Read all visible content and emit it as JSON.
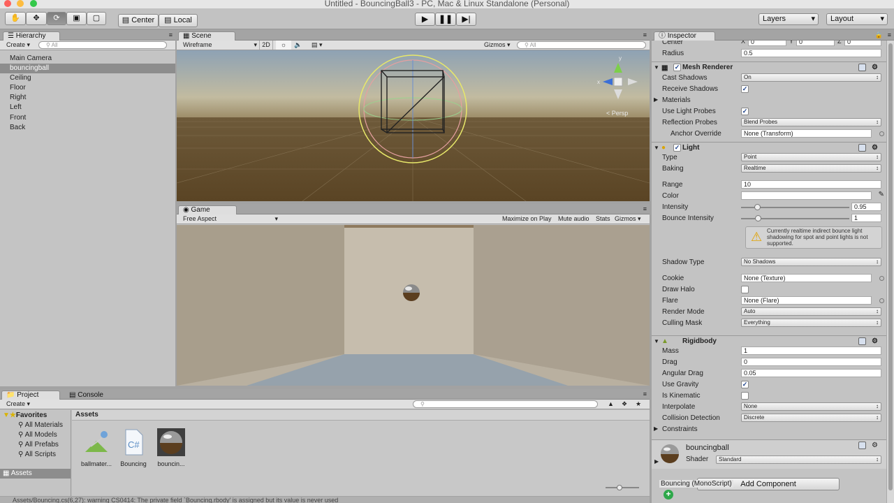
{
  "window": {
    "title": "Untitled - BouncingBall3 - PC, Mac & Linux Standalone (Personal)"
  },
  "toolbar": {
    "center": "Center",
    "local": "Local",
    "layers": "Layers",
    "layout": "Layout"
  },
  "hierarchy": {
    "tab": "Hierarchy",
    "create": "Create",
    "search": "All",
    "items": [
      "Main Camera",
      "bouncingball",
      "Ceiling",
      "Floor",
      "Right",
      "Left",
      "Front",
      "Back"
    ]
  },
  "scene": {
    "tab": "Scene",
    "shading": "Wireframe",
    "mode2d": "2D",
    "gizmos": "Gizmos",
    "search": "All",
    "persp": "Persp",
    "axes": {
      "y": "y",
      "x": "x"
    }
  },
  "game": {
    "tab": "Game",
    "aspect": "Free Aspect",
    "maximize": "Maximize on Play",
    "mute": "Mute audio",
    "stats": "Stats",
    "gizmos": "Gizmos"
  },
  "project": {
    "tab": "Project",
    "console_tab": "Console",
    "create": "Create",
    "favorites": "Favorites",
    "fav_items": [
      "All Materials",
      "All Models",
      "All Prefabs",
      "All Scripts"
    ],
    "assets_node": "Assets",
    "breadcrumb": "Assets",
    "assets": [
      {
        "name": "ballmater..."
      },
      {
        "name": "Bouncing"
      },
      {
        "name": "bouncin..."
      }
    ]
  },
  "status": {
    "message": "Assets/Bouncing.cs(6,27): warning CS0414: The private field `Bouncing.rbody' is assigned but its value is never used"
  },
  "inspector": {
    "tab": "Inspector",
    "collider": {
      "center_label": "Center",
      "x": "0",
      "y": "0",
      "z": "0",
      "radius_label": "Radius",
      "radius": "0.5"
    },
    "mesh_renderer": {
      "title": "Mesh Renderer",
      "cast_shadows_label": "Cast Shadows",
      "cast_shadows": "On",
      "receive_shadows_label": "Receive Shadows",
      "receive_shadows": true,
      "materials_label": "Materials",
      "use_light_probes_label": "Use Light Probes",
      "use_light_probes": true,
      "reflection_probes_label": "Reflection Probes",
      "reflection_probes": "Blend Probes",
      "anchor_override_label": "Anchor Override",
      "anchor_override": "None (Transform)"
    },
    "light": {
      "title": "Light",
      "type_label": "Type",
      "type": "Point",
      "baking_label": "Baking",
      "baking": "Realtime",
      "range_label": "Range",
      "range": "10",
      "color_label": "Color",
      "color": "#ffffff",
      "intensity_label": "Intensity",
      "intensity": "0.95",
      "intensity_fraction": 0.12,
      "bounce_label": "Bounce Intensity",
      "bounce": "1",
      "bounce_fraction": 0.13,
      "warning": "Currently realtime indirect bounce light shadowing for spot and point lights is not supported.",
      "shadow_type_label": "Shadow Type",
      "shadow_type": "No Shadows",
      "cookie_label": "Cookie",
      "cookie": "None (Texture)",
      "draw_halo_label": "Draw Halo",
      "draw_halo": false,
      "flare_label": "Flare",
      "flare": "None (Flare)",
      "render_mode_label": "Render Mode",
      "render_mode": "Auto",
      "culling_mask_label": "Culling Mask",
      "culling_mask": "Everything"
    },
    "rigidbody": {
      "title": "Rigidbody",
      "mass_label": "Mass",
      "mass": "1",
      "drag_label": "Drag",
      "drag": "0",
      "angular_drag_label": "Angular Drag",
      "angular_drag": "0.05",
      "use_gravity_label": "Use Gravity",
      "use_gravity": true,
      "is_kinematic_label": "Is Kinematic",
      "is_kinematic": false,
      "interpolate_label": "Interpolate",
      "interpolate": "None",
      "collision_label": "Collision Detection",
      "collision": "Discrete",
      "constraints_label": "Constraints"
    },
    "material": {
      "name": "bouncingball",
      "shader_label": "Shader",
      "shader": "Standard"
    },
    "drag_hint": "Bouncing (MonoScript)",
    "add_component": "Add Component"
  }
}
